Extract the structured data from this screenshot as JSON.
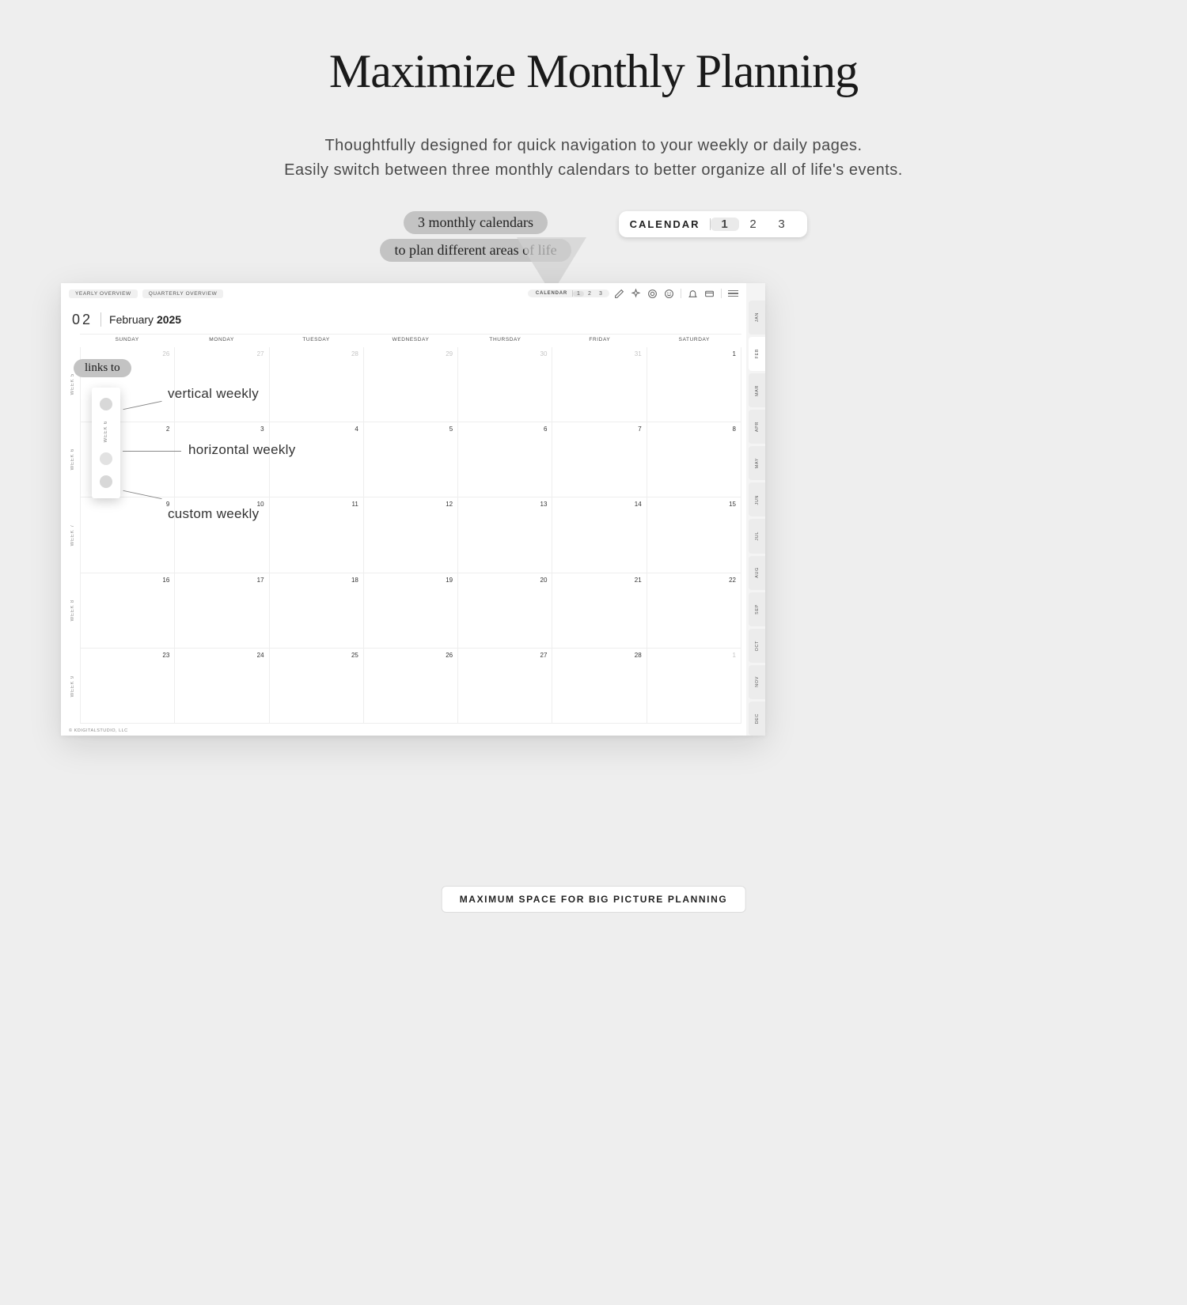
{
  "hero": {
    "title": "Maximize Monthly Planning",
    "sub1": "Thoughtfully designed for quick navigation to your weekly or daily pages.",
    "sub2": "Easily switch between three monthly calendars to better organize all of life's events."
  },
  "promo": {
    "pill1": "3 monthly calendars",
    "pill2": "to plan different areas of life",
    "big_switch_label": "CALENDAR",
    "big_switch_opts": [
      "1",
      "2",
      "3"
    ],
    "big_switch_selected": "1"
  },
  "links_callout": {
    "pill": "links to",
    "opt_vertical": "vertical weekly",
    "opt_horizontal": "horizontal weekly",
    "opt_custom": "custom weekly",
    "pop_label": "WEEK 6"
  },
  "planner": {
    "nav": {
      "yearly": "YEARLY OVERVIEW",
      "quarterly": "QUARTERLY OVERVIEW",
      "cal_label": "CALENDAR",
      "cal_opts": [
        "1",
        "2",
        "3"
      ],
      "cal_selected": "1"
    },
    "title": {
      "month_num": "02",
      "month_name": "February",
      "year": "2025"
    },
    "dow": [
      "SUNDAY",
      "MONDAY",
      "TUESDAY",
      "WEDNESDAY",
      "THURSDAY",
      "FRIDAY",
      "SATURDAY"
    ],
    "weeks": [
      "WEEK 5",
      "WEEK 6",
      "WEEK 7",
      "WEEK 8",
      "WEEK 9"
    ],
    "days": [
      [
        {
          "n": "26",
          "out": true
        },
        {
          "n": "27",
          "out": true
        },
        {
          "n": "28",
          "out": true
        },
        {
          "n": "29",
          "out": true
        },
        {
          "n": "30",
          "out": true
        },
        {
          "n": "31",
          "out": true
        },
        {
          "n": "1"
        }
      ],
      [
        {
          "n": "2"
        },
        {
          "n": "3"
        },
        {
          "n": "4"
        },
        {
          "n": "5"
        },
        {
          "n": "6"
        },
        {
          "n": "7"
        },
        {
          "n": "8"
        }
      ],
      [
        {
          "n": "9"
        },
        {
          "n": "10"
        },
        {
          "n": "11"
        },
        {
          "n": "12"
        },
        {
          "n": "13"
        },
        {
          "n": "14"
        },
        {
          "n": "15"
        }
      ],
      [
        {
          "n": "16"
        },
        {
          "n": "17"
        },
        {
          "n": "18"
        },
        {
          "n": "19"
        },
        {
          "n": "20"
        },
        {
          "n": "21"
        },
        {
          "n": "22"
        }
      ],
      [
        {
          "n": "23"
        },
        {
          "n": "24"
        },
        {
          "n": "25"
        },
        {
          "n": "26"
        },
        {
          "n": "27"
        },
        {
          "n": "28"
        },
        {
          "n": "1",
          "out": true
        }
      ]
    ],
    "month_tabs": [
      "JAN",
      "FEB",
      "MAR",
      "APR",
      "MAY",
      "JUN",
      "JUL",
      "AUG",
      "SEP",
      "OCT",
      "NOV",
      "DEC"
    ],
    "active_month_tab": "FEB",
    "credit": "© KDIGITALSTUDIO, LLC"
  },
  "bottom_chip": "MAXIMUM SPACE FOR BIG PICTURE PLANNING"
}
